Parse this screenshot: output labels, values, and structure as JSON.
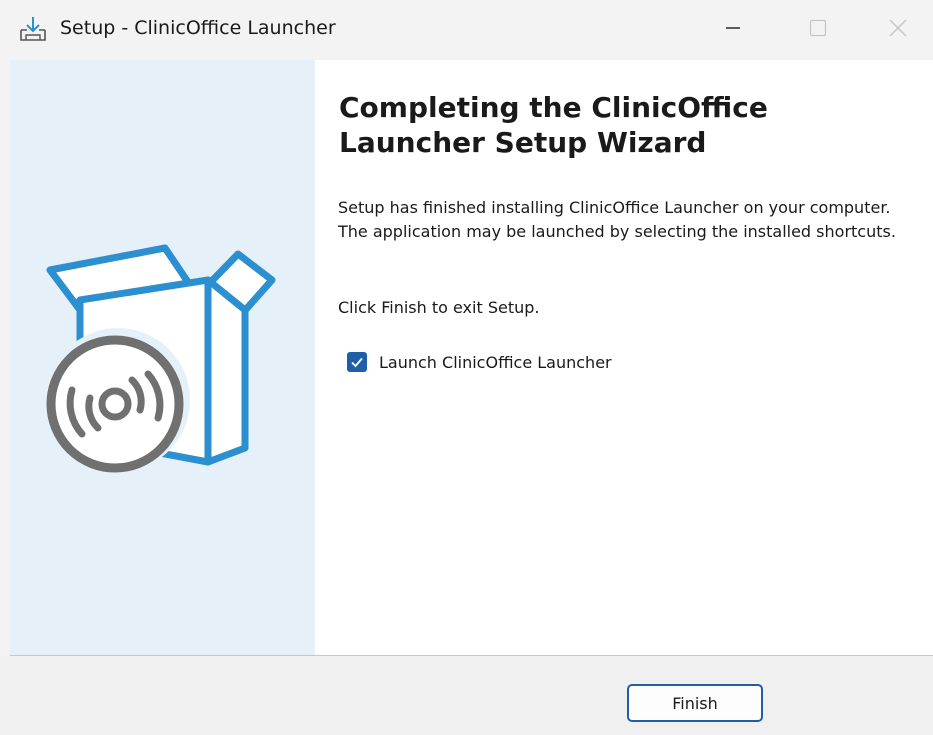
{
  "window": {
    "title": "Setup - ClinicOffice Launcher",
    "controls": {
      "minimize_icon": "minimize-icon",
      "maximize_icon": "maximize-icon",
      "close_icon": "close-icon"
    }
  },
  "wizard": {
    "heading": "Completing the ClinicOffice Launcher Setup Wizard",
    "paragraph_1": "Setup has finished installing ClinicOffice Launcher on your computer. The application may be launched by selecting the installed shortcuts.",
    "paragraph_2": "Click Finish to exit Setup.",
    "launch_checkbox": {
      "label": "Launch ClinicOffice Launcher",
      "checked": true
    }
  },
  "footer": {
    "finish_label": "Finish"
  },
  "colors": {
    "accent": "#1f5fa8",
    "art_blue": "#2b8fd0",
    "side_panel": "#e5f0f8",
    "disc_gray": "#707070"
  }
}
